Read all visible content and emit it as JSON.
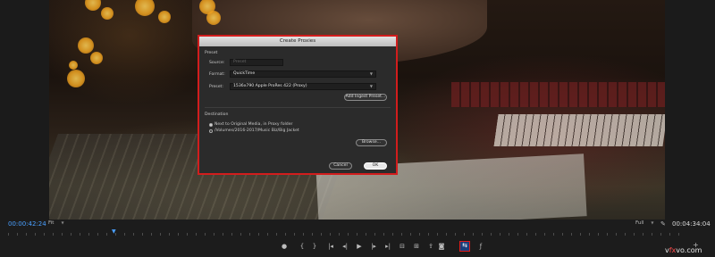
{
  "dialog": {
    "title": "Create Proxies",
    "preset_section": "Preset",
    "source_label": "Source:",
    "source_value": "Preset",
    "format_label": "Format:",
    "format_value": "QuickTime",
    "preset_label": "Preset:",
    "preset_value": "1536x790 Apple ProRes 422 (Proxy)",
    "add_ingest_preset": "Add Ingest Preset...",
    "destination_section": "Destination",
    "dest_option_1": "Next to Original Media, in Proxy folder",
    "dest_option_2": "/Volumes/2016-2017/Music Biz/Big Jacket",
    "dest_selected": "Next to Original Media, in Proxy folder",
    "browse_button": "Browse...",
    "cancel_button": "Cancel",
    "ok_button": "OK"
  },
  "monitor": {
    "current_time": "00:00:42:24",
    "zoom_value": "Fit",
    "resolution_value": "Full",
    "duration": "00:04:34:04"
  },
  "transport": {
    "buttons": [
      {
        "name": "marker-icon",
        "glyph": "●"
      },
      {
        "name": "mark-in-icon",
        "glyph": "{"
      },
      {
        "name": "mark-out-icon",
        "glyph": "}"
      },
      {
        "name": "go-to-in-icon",
        "glyph": "|◂"
      },
      {
        "name": "step-back-icon",
        "glyph": "◂|"
      },
      {
        "name": "play-icon",
        "glyph": "▶"
      },
      {
        "name": "step-forward-icon",
        "glyph": "|▸"
      },
      {
        "name": "go-to-out-icon",
        "glyph": "▸|"
      },
      {
        "name": "lift-icon",
        "glyph": "⊟"
      },
      {
        "name": "extract-icon",
        "glyph": "⊞"
      },
      {
        "name": "export-frame-icon",
        "glyph": "⇪"
      },
      {
        "name": "camera-icon",
        "glyph": "◙"
      },
      {
        "name": "toggle-proxies-icon",
        "glyph": "⇆"
      },
      {
        "name": "fx-icon",
        "glyph": "ƒ"
      }
    ],
    "highlighted": "toggle-proxies-icon"
  },
  "watermark": {
    "prefix": "v",
    "accent": "fx",
    "suffix": "vo.com"
  }
}
